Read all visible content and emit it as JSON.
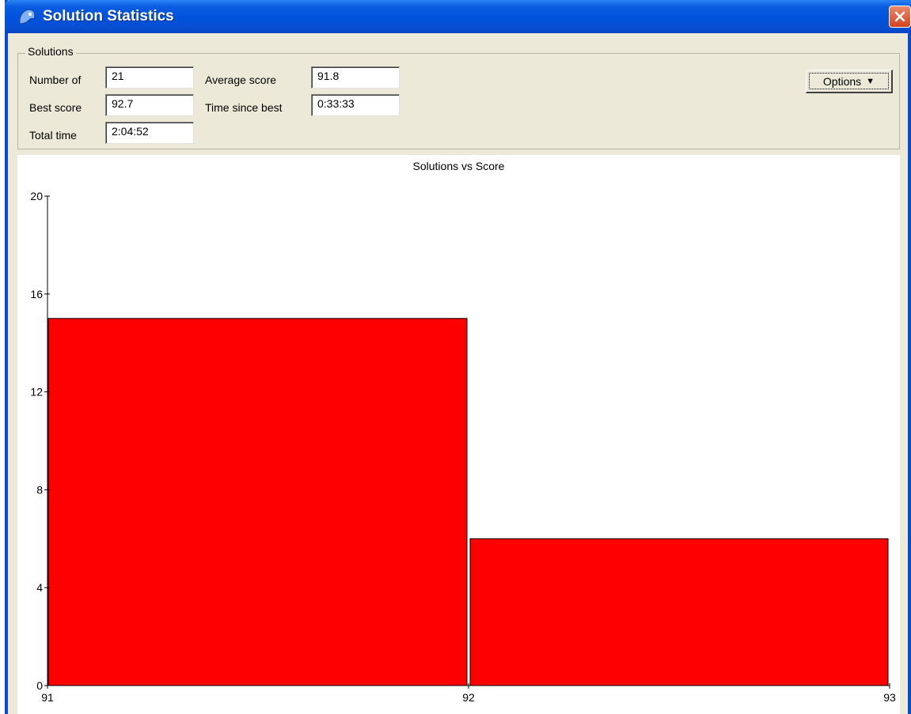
{
  "window": {
    "title": "Solution Statistics"
  },
  "group": {
    "label": "Solutions"
  },
  "fields": {
    "number_of": {
      "label": "Number of",
      "value": "21"
    },
    "average_score": {
      "label": "Average score",
      "value": "91.8"
    },
    "best_score": {
      "label": "Best score",
      "value": "92.7"
    },
    "time_since_best": {
      "label": "Time since best",
      "value": "0:33:33"
    },
    "total_time": {
      "label": "Total time",
      "value": "2:04:52"
    }
  },
  "options_button": {
    "label": "Options"
  },
  "colors": {
    "bar_fill": "#ff0000",
    "titlebar": "#0052dc",
    "window_bg": "#ece9d8"
  },
  "chart_data": {
    "type": "bar",
    "title": "Solutions vs Score",
    "xlabel": "",
    "ylabel": "",
    "bins": [
      {
        "x0": 91,
        "x1": 92,
        "value": 15
      },
      {
        "x0": 92,
        "x1": 93,
        "value": 6
      }
    ],
    "xticks": [
      "91",
      "92",
      "93"
    ],
    "yticks": [
      "0",
      "4",
      "8",
      "12",
      "16",
      "20"
    ],
    "xlim": [
      91,
      93
    ],
    "ylim": [
      0,
      20
    ],
    "grid": false
  }
}
